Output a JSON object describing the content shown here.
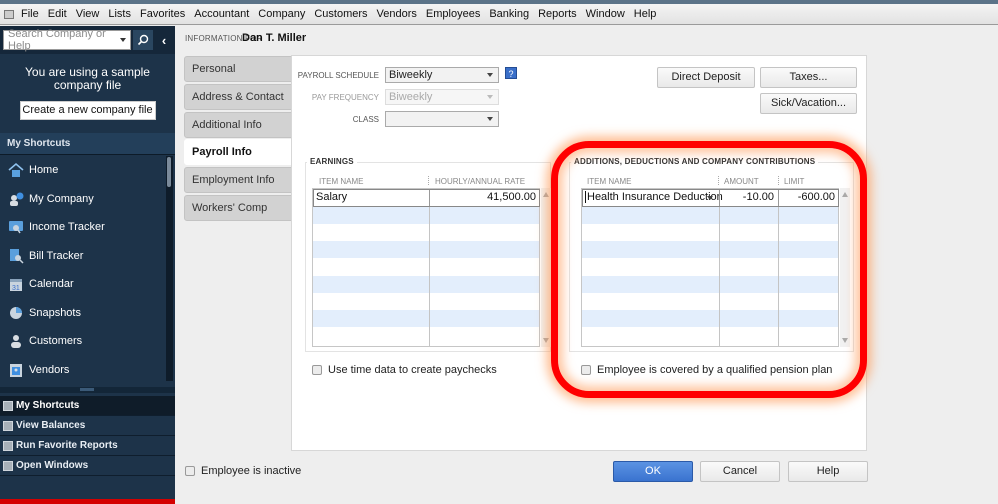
{
  "menubar": {
    "items": [
      "File",
      "Edit",
      "View",
      "Lists",
      "Favorites",
      "Accountant",
      "Company",
      "Customers",
      "Vendors",
      "Employees",
      "Banking",
      "Reports",
      "Window",
      "Help"
    ]
  },
  "sidebar": {
    "search_placeholder": "Search Company or Help",
    "sample_notice": "You are using a sample company file",
    "create_button": "Create a new company file",
    "shortcuts_header": "My Shortcuts",
    "nav_items": [
      {
        "label": "Home",
        "icon": "home-icon"
      },
      {
        "label": "My Company",
        "icon": "my-company-icon"
      },
      {
        "label": "Income Tracker",
        "icon": "income-tracker-icon"
      },
      {
        "label": "Bill Tracker",
        "icon": "bill-tracker-icon"
      },
      {
        "label": "Calendar",
        "icon": "calendar-icon"
      },
      {
        "label": "Snapshots",
        "icon": "snapshots-icon"
      },
      {
        "label": "Customers",
        "icon": "customers-icon"
      },
      {
        "label": "Vendors",
        "icon": "vendors-icon"
      }
    ],
    "bottom_nav": [
      {
        "label": "My Shortcuts",
        "active": true
      },
      {
        "label": "View Balances"
      },
      {
        "label": "Run Favorite Reports"
      },
      {
        "label": "Open Windows"
      }
    ]
  },
  "header": {
    "info_for_label": "INFORMATION FOR",
    "employee_name": "Dan T. Miller"
  },
  "tabs": [
    {
      "label": "Personal"
    },
    {
      "label": "Address & Contact"
    },
    {
      "label": "Additional Info"
    },
    {
      "label": "Payroll Info",
      "active": true
    },
    {
      "label": "Employment Info"
    },
    {
      "label": "Workers' Comp"
    }
  ],
  "payroll": {
    "schedule_label": "PAYROLL SCHEDULE",
    "schedule_value": "Biweekly",
    "frequency_label": "PAY FREQUENCY",
    "frequency_value": "Biweekly",
    "class_label": "CLASS",
    "class_value": "",
    "help_icon": "?",
    "buttons": {
      "direct_deposit": "Direct Deposit",
      "taxes": "Taxes...",
      "sick_vacation": "Sick/Vacation..."
    }
  },
  "earnings": {
    "title": "EARNINGS",
    "columns": [
      "ITEM NAME",
      "HOURLY/ANNUAL RATE"
    ],
    "rows": [
      {
        "item": "Salary",
        "rate": "41,500.00"
      }
    ],
    "checkbox": "Use time data to create paychecks"
  },
  "additions": {
    "title": "ADDITIONS, DEDUCTIONS AND COMPANY CONTRIBUTIONS",
    "columns": [
      "ITEM NAME",
      "AMOUNT",
      "LIMIT"
    ],
    "rows": [
      {
        "item": "Health Insurance Deduction",
        "amount": "-10.00",
        "limit": "-600.00"
      }
    ],
    "checkbox": "Employee is covered by a qualified pension plan"
  },
  "footer": {
    "inactive_checkbox": "Employee is inactive",
    "ok": "OK",
    "cancel": "Cancel",
    "help": "Help"
  },
  "colors": {
    "sidebar_bg": "#1d3349",
    "highlight_ring": "#ff0000",
    "ok_button": "#3a73cf",
    "grid_alt_row": "#e3eefc"
  }
}
